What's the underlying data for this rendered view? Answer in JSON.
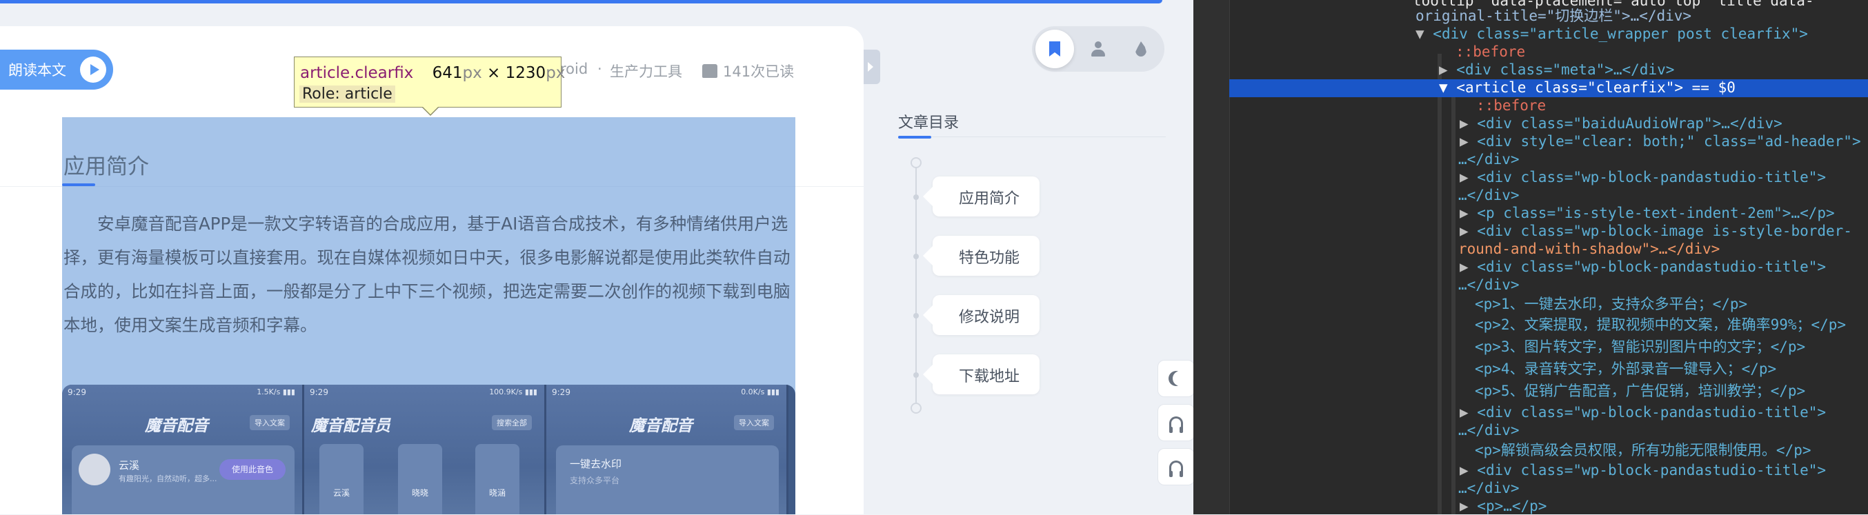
{
  "page": {
    "read_aloud_label": "朗读本文",
    "meta": {
      "category_partial": "roid",
      "separator": "·",
      "tag": "生产力工具",
      "views": "141次已读"
    },
    "article": {
      "section_title": "应用简介",
      "body": "安卓魔音配音APP是一款文字转语音的合成应用，基于AI语音合成技术，有多种情绪供用户选择，更有海量模板可以直接套用。现在自媒体视频如日中天，很多电影解说都是使用此类软件自动合成的，比如在抖音上面，一般都是分了上中下三个视频，把选定需要二次创作的视频下载到电脑本地，使用文案生成音频和字幕。"
    },
    "screenshot_phones": [
      {
        "time": "9:29",
        "status": "1.5K/s ▮▮▮",
        "app": "魔音配音",
        "chip": "导入文案",
        "name": "云溪",
        "sub": "有趣阳光，自然动听，超多...",
        "button": "使用此音色"
      },
      {
        "time": "9:29",
        "status": "100.9K/s ▮▮▮",
        "app": "魔音配音员",
        "chip": "搜索全部",
        "people": [
          "云溪",
          "晓晓",
          "晓涵"
        ]
      },
      {
        "time": "9:29",
        "status": "0.0K/s ▮▮▮",
        "app": "魔音配音",
        "chip": "导入文案",
        "row_label": "一键去水印",
        "row_sub": "支持众多平台"
      }
    ]
  },
  "devtools_tooltip": {
    "selector": "article.clearfix",
    "width": "641",
    "height": "1230",
    "unit": "px",
    "times": "×",
    "role": "Role: article"
  },
  "sidebar": {
    "tabs": [
      {
        "name": "toc",
        "icon": "bookmark-icon",
        "active": true
      },
      {
        "name": "user",
        "icon": "user-icon",
        "active": false
      },
      {
        "name": "hot",
        "icon": "flame-icon",
        "active": false
      }
    ],
    "toc_title": "文章目录",
    "toc_items": [
      "应用简介",
      "特色功能",
      "修改说明",
      "下载地址"
    ],
    "float_buttons": [
      "moon-icon",
      "headset-icon",
      "customer-service-icon"
    ]
  },
  "devtools": {
    "lines": [
      {
        "text": "tooltip\" data-placement=\"auto top\" title data-"
      },
      {
        "text": "original-title=\"切换边栏\">…</div>"
      },
      {
        "text": "<div class=\"article_wrapper post clearfix\">"
      },
      {
        "text": "::before"
      },
      {
        "text": "<div class=\"meta\">…</div>"
      },
      {
        "text": "<article class=\"clearfix\"> == $0"
      },
      {
        "text": "::before"
      },
      {
        "text": "<div class=\"baiduAudioWrap\">…</div>"
      },
      {
        "text": "<div style=\"clear: both;\" class=\"ad-header\">"
      },
      {
        "text": "…</div>"
      },
      {
        "text": "<div class=\"wp-block-pandastudio-title\">"
      },
      {
        "text": "…</div>"
      },
      {
        "text": "<p class=\"is-style-text-indent-2em\">…</p>"
      },
      {
        "text": "<div class=\"wp-block-image is-style-border-"
      },
      {
        "text": "round-and-with-shadow\">…</div>"
      },
      {
        "text": "<div class=\"wp-block-pandastudio-title\">"
      },
      {
        "text": "…</div>"
      },
      {
        "text": "<p>1、一键去水印，支持众多平台；</p>"
      },
      {
        "text": "<p>2、文案提取，提取视频中的文案，准确率99%；</p>"
      },
      {
        "text": "<p>3、图片转文字，智能识别图片中的文字；</p>"
      },
      {
        "text": "<p>4、录音转文字，外部录音一键导入；</p>"
      },
      {
        "text": "<p>5、促销广告配音，广告促销，培训教学；</p>"
      },
      {
        "text": "<div class=\"wp-block-pandastudio-title\">"
      },
      {
        "text": "…</div>"
      },
      {
        "text": "<p>解锁高级会员权限，所有功能无限制使用。</p>"
      },
      {
        "text": "<div class=\"wp-block-pandastudio-title\">"
      },
      {
        "text": "…</div>"
      },
      {
        "text": "<p>…</p>"
      }
    ]
  }
}
